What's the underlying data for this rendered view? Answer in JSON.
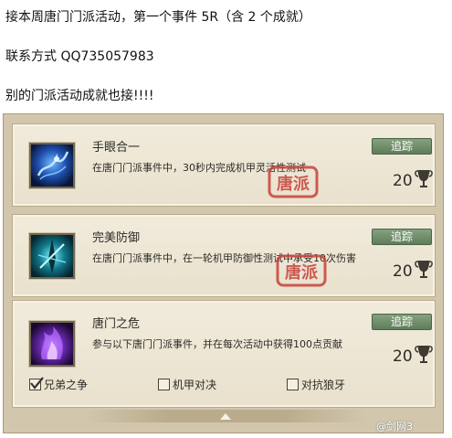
{
  "post": {
    "line1": "接本周唐门门派活动，第一个事件 5R（含 2 个成就）",
    "line2": "联系方式 QQ735057983",
    "line3": "别的门派活动成就也接!!!!"
  },
  "achievements": [
    {
      "title": "手眼合一",
      "description": "在唐门门派事件中，30秒内完成机甲灵活性测试",
      "track_label": "追踪",
      "reward": "20",
      "stamp_text": "唐派",
      "icon": "blue-dragon-skill-icon"
    },
    {
      "title": "完美防御",
      "description": "在唐门门派事件中，在一轮机甲防御性测试中承受10次伤害",
      "track_label": "追踪",
      "reward": "20",
      "stamp_text": "唐派",
      "icon": "cyan-blade-skill-icon"
    },
    {
      "title": "唐门之危",
      "description": "参与以下唐门门派事件，并在每次活动中获得100点贡献",
      "track_label": "追踪",
      "reward": "20",
      "icon": "purple-flame-skill-icon",
      "sub_items": [
        {
          "label": "兄弟之争",
          "checked": true
        },
        {
          "label": "机甲对决",
          "checked": false
        },
        {
          "label": "对抗狼牙",
          "checked": false
        }
      ]
    }
  ],
  "watermark": "@剑网3",
  "colors": {
    "panel_bg": "#d2c7ad",
    "card_bg": "#efe8d7",
    "track_button": "#6f8d69",
    "stamp_red": "#c8413a"
  }
}
